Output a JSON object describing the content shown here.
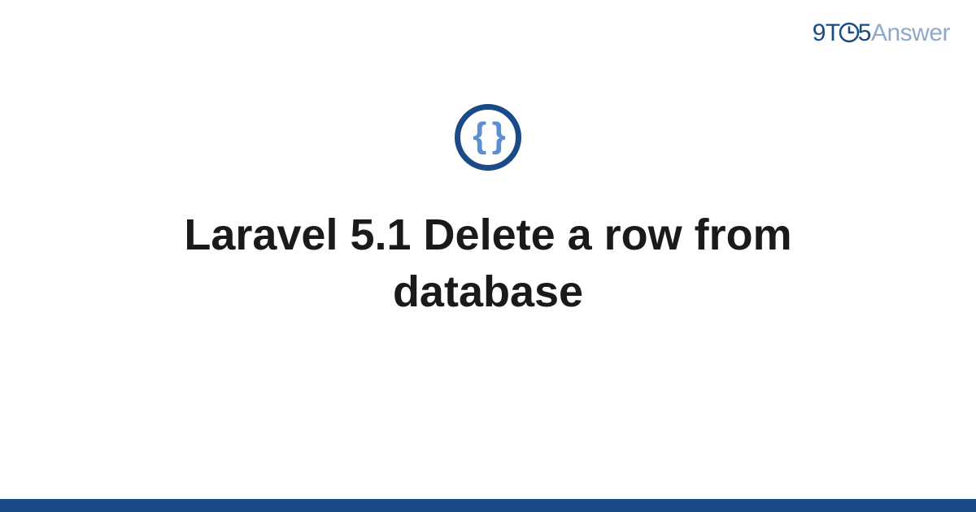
{
  "brand": {
    "prefix_9t": "9T",
    "suffix_5": "5",
    "answer": "Answer"
  },
  "icon": {
    "braces": "{ }"
  },
  "title": "Laravel 5.1 Delete a row from database",
  "colors": {
    "brand_dark": "#194b87",
    "brand_light": "#8ea9c9",
    "icon_border": "#1a4b87",
    "icon_braces": "#5a8fd4"
  }
}
